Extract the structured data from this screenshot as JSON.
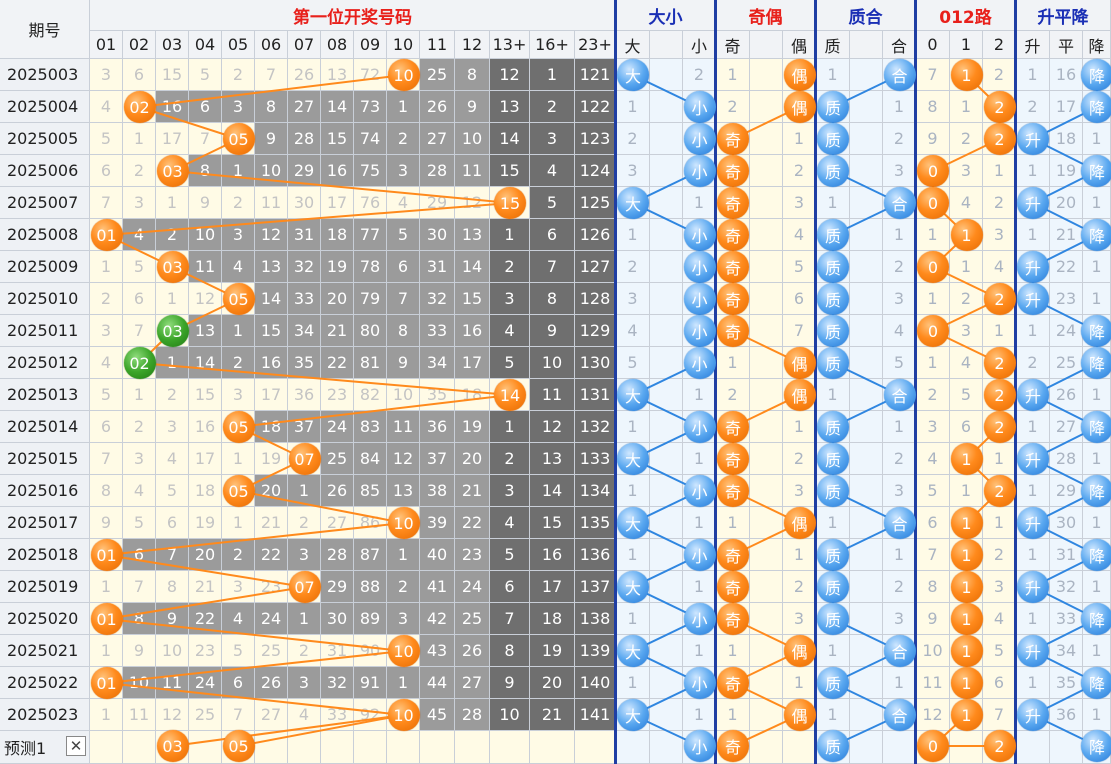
{
  "header": {
    "period_label": "期号",
    "groups": [
      {
        "label": "第一位开奖号码",
        "color": "#e8201b"
      },
      {
        "label": "大小",
        "color": "#1a2fb5"
      },
      {
        "label": "奇偶",
        "color": "#e8201b"
      },
      {
        "label": "质合",
        "color": "#1a2fb5"
      },
      {
        "label": "012路",
        "color": "#e8201b"
      },
      {
        "label": "升平降",
        "color": "#1a2fb5"
      }
    ],
    "num_cols": [
      "01",
      "02",
      "03",
      "04",
      "05",
      "06",
      "07",
      "08",
      "09",
      "10",
      "11",
      "12",
      "13+",
      "16+",
      "23+"
    ],
    "dx_cols": [
      "大",
      "",
      "小"
    ],
    "jo_cols": [
      "奇",
      "",
      "偶"
    ],
    "zh_cols": [
      "质",
      "",
      "合"
    ],
    "lu_cols": [
      "0",
      "1",
      "2"
    ],
    "spj_cols": [
      "升",
      "平",
      "降"
    ]
  },
  "rows": [
    {
      "period": "2025003",
      "nums": [
        "3",
        "6",
        "15",
        "5",
        "2",
        "7",
        "26",
        "13",
        "72",
        "10",
        "25",
        "8",
        "12",
        "1",
        "121"
      ],
      "dx": [
        "大",
        "",
        "2"
      ],
      "jo": [
        "1",
        "",
        "偶"
      ],
      "zh": [
        "1",
        "",
        "合"
      ],
      "lu": [
        "7",
        "1",
        "2"
      ],
      "spj": [
        "1",
        "16",
        "降"
      ]
    },
    {
      "period": "2025004",
      "nums": [
        "4",
        "02",
        "16",
        "6",
        "3",
        "8",
        "27",
        "14",
        "73",
        "1",
        "26",
        "9",
        "13",
        "2",
        "122"
      ],
      "dx": [
        "1",
        "",
        "小"
      ],
      "jo": [
        "2",
        "",
        "偶"
      ],
      "zh": [
        "质",
        "",
        "1"
      ],
      "lu": [
        "8",
        "1",
        "2"
      ],
      "spj": [
        "2",
        "17",
        "降"
      ]
    },
    {
      "period": "2025005",
      "nums": [
        "5",
        "1",
        "17",
        "7",
        "05",
        "9",
        "28",
        "15",
        "74",
        "2",
        "27",
        "10",
        "14",
        "3",
        "123"
      ],
      "dx": [
        "2",
        "",
        "小"
      ],
      "jo": [
        "奇",
        "",
        "1"
      ],
      "zh": [
        "质",
        "",
        "2"
      ],
      "lu": [
        "9",
        "2",
        "2"
      ],
      "spj": [
        "升",
        "18",
        "1"
      ]
    },
    {
      "period": "2025006",
      "nums": [
        "6",
        "2",
        "03",
        "8",
        "1",
        "10",
        "29",
        "16",
        "75",
        "3",
        "28",
        "11",
        "15",
        "4",
        "124"
      ],
      "dx": [
        "3",
        "",
        "小"
      ],
      "jo": [
        "奇",
        "",
        "2"
      ],
      "zh": [
        "质",
        "",
        "3"
      ],
      "lu": [
        "0",
        "3",
        "1"
      ],
      "spj": [
        "1",
        "19",
        "降"
      ]
    },
    {
      "period": "2025007",
      "nums": [
        "7",
        "3",
        "1",
        "9",
        "2",
        "11",
        "30",
        "17",
        "76",
        "4",
        "29",
        "12",
        "15",
        "5",
        "125"
      ],
      "dx": [
        "大",
        "",
        "1"
      ],
      "jo": [
        "奇",
        "",
        "3"
      ],
      "zh": [
        "1",
        "",
        "合"
      ],
      "lu": [
        "0",
        "4",
        "2"
      ],
      "spj": [
        "升",
        "20",
        "1"
      ]
    },
    {
      "period": "2025008",
      "nums": [
        "01",
        "4",
        "2",
        "10",
        "3",
        "12",
        "31",
        "18",
        "77",
        "5",
        "30",
        "13",
        "1",
        "6",
        "126"
      ],
      "dx": [
        "1",
        "",
        "小"
      ],
      "jo": [
        "奇",
        "",
        "4"
      ],
      "zh": [
        "质",
        "",
        "1"
      ],
      "lu": [
        "1",
        "1",
        "3"
      ],
      "spj": [
        "1",
        "21",
        "降"
      ]
    },
    {
      "period": "2025009",
      "nums": [
        "1",
        "5",
        "03",
        "11",
        "4",
        "13",
        "32",
        "19",
        "78",
        "6",
        "31",
        "14",
        "2",
        "7",
        "127"
      ],
      "dx": [
        "2",
        "",
        "小"
      ],
      "jo": [
        "奇",
        "",
        "5"
      ],
      "zh": [
        "质",
        "",
        "2"
      ],
      "lu": [
        "0",
        "1",
        "4"
      ],
      "spj": [
        "升",
        "22",
        "1"
      ]
    },
    {
      "period": "2025010",
      "nums": [
        "2",
        "6",
        "1",
        "12",
        "05",
        "14",
        "33",
        "20",
        "79",
        "7",
        "32",
        "15",
        "3",
        "8",
        "128"
      ],
      "dx": [
        "3",
        "",
        "小"
      ],
      "jo": [
        "奇",
        "",
        "6"
      ],
      "zh": [
        "质",
        "",
        "3"
      ],
      "lu": [
        "1",
        "2",
        "2"
      ],
      "spj": [
        "升",
        "23",
        "1"
      ]
    },
    {
      "period": "2025011",
      "nums": [
        "3",
        "7",
        "03",
        "13",
        "1",
        "15",
        "34",
        "21",
        "80",
        "8",
        "33",
        "16",
        "4",
        "9",
        "129"
      ],
      "dx": [
        "4",
        "",
        "小"
      ],
      "jo": [
        "奇",
        "",
        "7"
      ],
      "zh": [
        "质",
        "",
        "4"
      ],
      "lu": [
        "0",
        "3",
        "1"
      ],
      "spj": [
        "1",
        "24",
        "降"
      ]
    },
    {
      "period": "2025012",
      "nums": [
        "4",
        "02",
        "1",
        "14",
        "2",
        "16",
        "35",
        "22",
        "81",
        "9",
        "34",
        "17",
        "5",
        "10",
        "130"
      ],
      "dx": [
        "5",
        "",
        "小"
      ],
      "jo": [
        "1",
        "",
        "偶"
      ],
      "zh": [
        "质",
        "",
        "5"
      ],
      "lu": [
        "1",
        "4",
        "2"
      ],
      "spj": [
        "2",
        "25",
        "降"
      ]
    },
    {
      "period": "2025013",
      "nums": [
        "5",
        "1",
        "2",
        "15",
        "3",
        "17",
        "36",
        "23",
        "82",
        "10",
        "35",
        "18",
        "14",
        "11",
        "131"
      ],
      "dx": [
        "大",
        "",
        "1"
      ],
      "jo": [
        "2",
        "",
        "偶"
      ],
      "zh": [
        "1",
        "",
        "合"
      ],
      "lu": [
        "2",
        "5",
        "2"
      ],
      "spj": [
        "升",
        "26",
        "1"
      ]
    },
    {
      "period": "2025014",
      "nums": [
        "6",
        "2",
        "3",
        "16",
        "05",
        "18",
        "37",
        "24",
        "83",
        "11",
        "36",
        "19",
        "1",
        "12",
        "132"
      ],
      "dx": [
        "1",
        "",
        "小"
      ],
      "jo": [
        "奇",
        "",
        "1"
      ],
      "zh": [
        "质",
        "",
        "1"
      ],
      "lu": [
        "3",
        "6",
        "2"
      ],
      "spj": [
        "1",
        "27",
        "降"
      ]
    },
    {
      "period": "2025015",
      "nums": [
        "7",
        "3",
        "4",
        "17",
        "1",
        "19",
        "07",
        "25",
        "84",
        "12",
        "37",
        "20",
        "2",
        "13",
        "133"
      ],
      "dx": [
        "大",
        "",
        "1"
      ],
      "jo": [
        "奇",
        "",
        "2"
      ],
      "zh": [
        "质",
        "",
        "2"
      ],
      "lu": [
        "4",
        "1",
        "1"
      ],
      "spj": [
        "升",
        "28",
        "1"
      ]
    },
    {
      "period": "2025016",
      "nums": [
        "8",
        "4",
        "5",
        "18",
        "05",
        "20",
        "1",
        "26",
        "85",
        "13",
        "38",
        "21",
        "3",
        "14",
        "134"
      ],
      "dx": [
        "1",
        "",
        "小"
      ],
      "jo": [
        "奇",
        "",
        "3"
      ],
      "zh": [
        "质",
        "",
        "3"
      ],
      "lu": [
        "5",
        "1",
        "2"
      ],
      "spj": [
        "1",
        "29",
        "降"
      ]
    },
    {
      "period": "2025017",
      "nums": [
        "9",
        "5",
        "6",
        "19",
        "1",
        "21",
        "2",
        "27",
        "86",
        "10",
        "39",
        "22",
        "4",
        "15",
        "135"
      ],
      "dx": [
        "大",
        "",
        "1"
      ],
      "jo": [
        "1",
        "",
        "偶"
      ],
      "zh": [
        "1",
        "",
        "合"
      ],
      "lu": [
        "6",
        "1",
        "1"
      ],
      "spj": [
        "升",
        "30",
        "1"
      ]
    },
    {
      "period": "2025018",
      "nums": [
        "01",
        "6",
        "7",
        "20",
        "2",
        "22",
        "3",
        "28",
        "87",
        "1",
        "40",
        "23",
        "5",
        "16",
        "136"
      ],
      "dx": [
        "1",
        "",
        "小"
      ],
      "jo": [
        "奇",
        "",
        "1"
      ],
      "zh": [
        "质",
        "",
        "1"
      ],
      "lu": [
        "7",
        "1",
        "2"
      ],
      "spj": [
        "1",
        "31",
        "降"
      ]
    },
    {
      "period": "2025019",
      "nums": [
        "1",
        "7",
        "8",
        "21",
        "3",
        "23",
        "07",
        "29",
        "88",
        "2",
        "41",
        "24",
        "6",
        "17",
        "137"
      ],
      "dx": [
        "大",
        "",
        "1"
      ],
      "jo": [
        "奇",
        "",
        "2"
      ],
      "zh": [
        "质",
        "",
        "2"
      ],
      "lu": [
        "8",
        "1",
        "3"
      ],
      "spj": [
        "升",
        "32",
        "1"
      ]
    },
    {
      "period": "2025020",
      "nums": [
        "01",
        "8",
        "9",
        "22",
        "4",
        "24",
        "1",
        "30",
        "89",
        "3",
        "42",
        "25",
        "7",
        "18",
        "138"
      ],
      "dx": [
        "1",
        "",
        "小"
      ],
      "jo": [
        "奇",
        "",
        "3"
      ],
      "zh": [
        "质",
        "",
        "3"
      ],
      "lu": [
        "9",
        "1",
        "4"
      ],
      "spj": [
        "1",
        "33",
        "降"
      ]
    },
    {
      "period": "2025021",
      "nums": [
        "1",
        "9",
        "10",
        "23",
        "5",
        "25",
        "2",
        "31",
        "90",
        "10",
        "43",
        "26",
        "8",
        "19",
        "139"
      ],
      "dx": [
        "大",
        "",
        "1"
      ],
      "jo": [
        "1",
        "",
        "偶"
      ],
      "zh": [
        "1",
        "",
        "合"
      ],
      "lu": [
        "10",
        "1",
        "5"
      ],
      "spj": [
        "升",
        "34",
        "1"
      ]
    },
    {
      "period": "2025022",
      "nums": [
        "01",
        "10",
        "11",
        "24",
        "6",
        "26",
        "3",
        "32",
        "91",
        "1",
        "44",
        "27",
        "9",
        "20",
        "140"
      ],
      "dx": [
        "1",
        "",
        "小"
      ],
      "jo": [
        "奇",
        "",
        "1"
      ],
      "zh": [
        "质",
        "",
        "1"
      ],
      "lu": [
        "11",
        "1",
        "6"
      ],
      "spj": [
        "1",
        "35",
        "降"
      ]
    },
    {
      "period": "2025023",
      "nums": [
        "1",
        "11",
        "12",
        "25",
        "7",
        "27",
        "4",
        "33",
        "92",
        "10",
        "45",
        "28",
        "10",
        "21",
        "141"
      ],
      "dx": [
        "大",
        "",
        "1"
      ],
      "jo": [
        "1",
        "",
        "偶"
      ],
      "zh": [
        "1",
        "",
        "合"
      ],
      "lu": [
        "12",
        "1",
        "7"
      ],
      "spj": [
        "升",
        "36",
        "1"
      ]
    }
  ],
  "prediction": {
    "label": "预测1",
    "close_glyph": "✕",
    "nums": [
      "",
      "",
      "03",
      "",
      "05",
      "",
      "",
      "",
      "",
      "",
      "",
      "",
      "",
      "",
      ""
    ],
    "dx": [
      "",
      "",
      "小"
    ],
    "jo": [
      "奇",
      "",
      ""
    ],
    "zh": [
      "质",
      "",
      ""
    ],
    "lu": [
      "0",
      "",
      "2"
    ],
    "spj": [
      "",
      "",
      "降"
    ]
  },
  "hits": [
    {
      "row": 0,
      "col": 9
    },
    {
      "row": 1,
      "col": 1
    },
    {
      "row": 2,
      "col": 4
    },
    {
      "row": 3,
      "col": 2
    },
    {
      "row": 4,
      "col": 12
    },
    {
      "row": 5,
      "col": 0
    },
    {
      "row": 6,
      "col": 2
    },
    {
      "row": 7,
      "col": 4
    },
    {
      "row": 8,
      "col": 2,
      "green": true
    },
    {
      "row": 9,
      "col": 1,
      "green": true
    },
    {
      "row": 10,
      "col": 12
    },
    {
      "row": 11,
      "col": 4
    },
    {
      "row": 12,
      "col": 6
    },
    {
      "row": 13,
      "col": 4
    },
    {
      "row": 14,
      "col": 9
    },
    {
      "row": 15,
      "col": 0
    },
    {
      "row": 16,
      "col": 6
    },
    {
      "row": 17,
      "col": 0
    },
    {
      "row": 18,
      "col": 9
    },
    {
      "row": 19,
      "col": 0
    },
    {
      "row": 20,
      "col": 9
    }
  ],
  "colors": {
    "orange": "#ff8a1c",
    "green": "#3ca52a",
    "blue": "#2f86e0",
    "header_blue": "#1a2fb5",
    "header_red": "#e8201b"
  }
}
